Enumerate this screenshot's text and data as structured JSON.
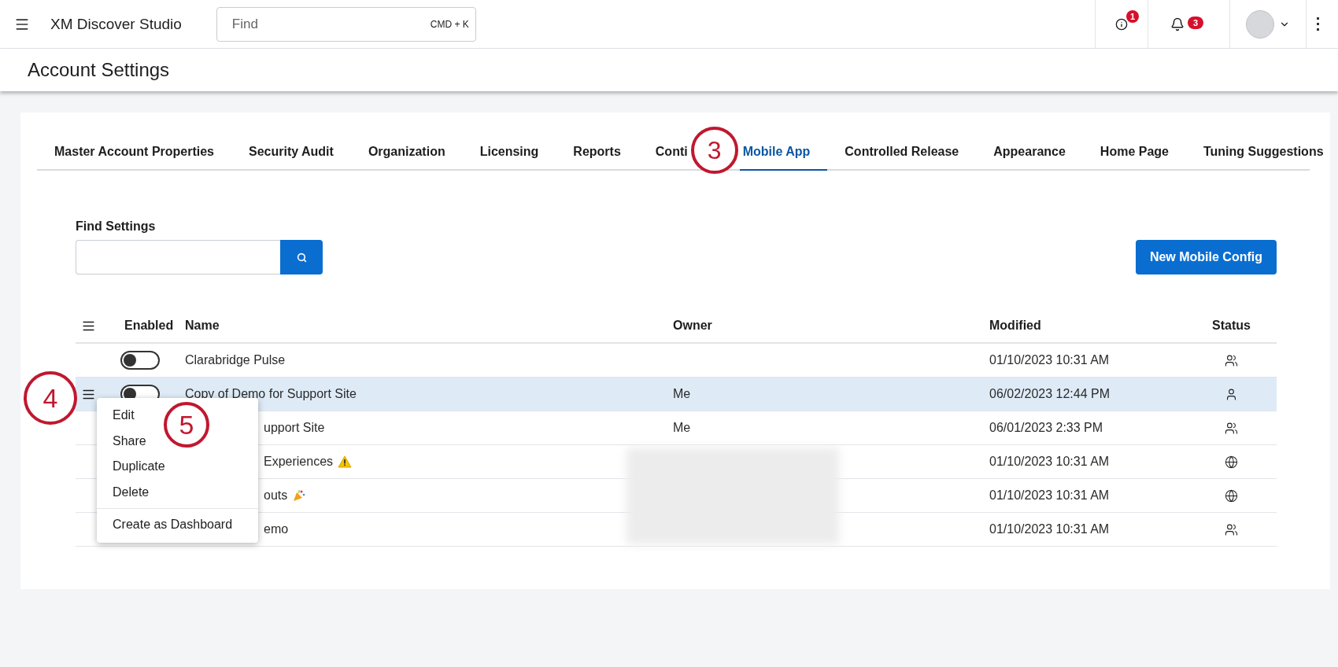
{
  "header": {
    "app_name": "XM Discover Studio",
    "search": {
      "placeholder": "Find",
      "shortcut": "CMD + K"
    },
    "info_badge": "1",
    "notifications_badge": "3"
  },
  "page_title": "Account Settings",
  "tabs": [
    {
      "label": "Master Account Properties",
      "selected": false
    },
    {
      "label": "Security Audit",
      "selected": false
    },
    {
      "label": "Organization",
      "selected": false
    },
    {
      "label": "Licensing",
      "selected": false
    },
    {
      "label": "Reports",
      "selected": false
    },
    {
      "label": "Conti",
      "selected": false
    },
    {
      "label": "Mobile App",
      "selected": true
    },
    {
      "label": "Controlled Release",
      "selected": false
    },
    {
      "label": "Appearance",
      "selected": false
    },
    {
      "label": "Home Page",
      "selected": false
    },
    {
      "label": "Tuning Suggestions",
      "selected": false
    }
  ],
  "find_settings": {
    "label": "Find Settings"
  },
  "new_button": "New Mobile Config",
  "table": {
    "columns": [
      "Enabled",
      "Name",
      "Owner",
      "Modified",
      "Status"
    ],
    "rows": [
      {
        "on": false,
        "name": "Clarabridge Pulse",
        "modified": "01/10/2023 10:31 AM",
        "status": {
          "kind": "group"
        },
        "selected": false,
        "menu_open": false
      },
      {
        "on": false,
        "name": "Copy of Demo for Support Site",
        "owner": "Me",
        "modified": "06/02/2023 12:44 PM",
        "status": {
          "kind": "person"
        },
        "selected": true,
        "menu_open": true
      },
      {
        "name": "upport Site",
        "owner": "Me",
        "modified": "06/01/2023 2:33 PM",
        "status": {
          "kind": "group"
        },
        "selected": false,
        "menu_open": false
      },
      {
        "name": "Experiences",
        "name_icon": {
          "kind": "warning"
        },
        "owner_blurred": true,
        "modified": "01/10/2023 10:31 AM",
        "status": {
          "kind": "globe"
        },
        "selected": false,
        "menu_open": false
      },
      {
        "name": "outs",
        "name_icon": {
          "kind": "party"
        },
        "owner_blurred": true,
        "modified": "01/10/2023 10:31 AM",
        "status": {
          "kind": "globe"
        },
        "selected": false,
        "menu_open": false
      },
      {
        "name": "emo",
        "owner_blurred": true,
        "modified": "01/10/2023 10:31 AM",
        "status": {
          "kind": "group"
        },
        "selected": false,
        "menu_open": false
      }
    ]
  },
  "row_menu": {
    "items": [
      "Edit",
      "Share",
      "Duplicate",
      "Delete"
    ],
    "footer_item": "Create as Dashboard"
  },
  "callouts": [
    {
      "label": "3"
    },
    {
      "label": "4"
    },
    {
      "label": "5"
    }
  ]
}
